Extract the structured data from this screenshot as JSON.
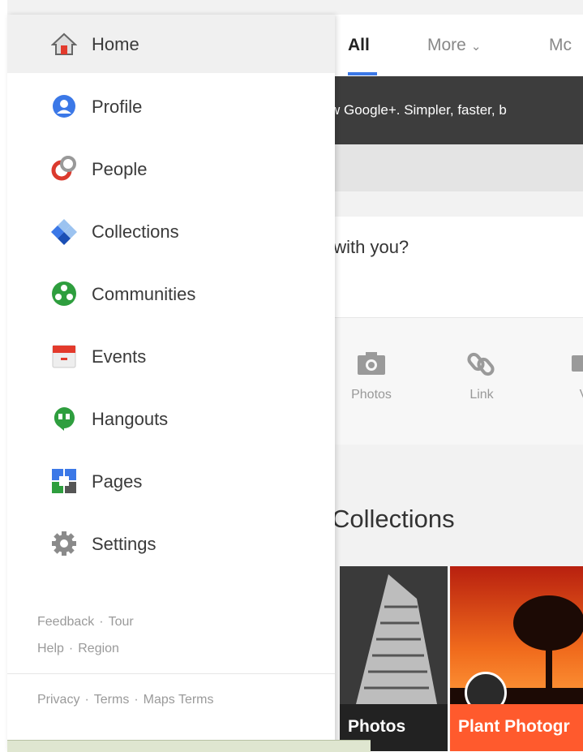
{
  "topbar": {
    "tabs": [
      {
        "label": "All",
        "active": true
      },
      {
        "label": "More"
      },
      {
        "label": "Mc"
      }
    ]
  },
  "banner": {
    "text": "w Google+.  Simpler, faster, b"
  },
  "share": {
    "prompt": "/ with you?",
    "actions": [
      {
        "label": "Photos",
        "icon": "camera-icon"
      },
      {
        "label": "Link",
        "icon": "link-icon"
      },
      {
        "label": "V",
        "icon": "video-icon"
      }
    ]
  },
  "collections": {
    "title": "Collections",
    "tiles": [
      {
        "caption": "Photos"
      },
      {
        "caption": "Plant Photogr"
      }
    ]
  },
  "drawer": {
    "items": [
      {
        "label": "Home",
        "icon": "home-icon",
        "active": true
      },
      {
        "label": "Profile",
        "icon": "profile-icon"
      },
      {
        "label": "People",
        "icon": "people-icon"
      },
      {
        "label": "Collections",
        "icon": "collections-icon"
      },
      {
        "label": "Communities",
        "icon": "communities-icon"
      },
      {
        "label": "Events",
        "icon": "events-icon"
      },
      {
        "label": "Hangouts",
        "icon": "hangouts-icon"
      },
      {
        "label": "Pages",
        "icon": "pages-icon"
      },
      {
        "label": "Settings",
        "icon": "settings-icon"
      }
    ],
    "footer": {
      "row1": [
        "Feedback",
        "Tour"
      ],
      "row2": [
        "Help",
        "Region"
      ],
      "row3": [
        "Privacy",
        "Terms",
        "Maps Terms"
      ]
    }
  },
  "colors": {
    "accent": "#3b78e7",
    "banner": "#3d3d3d",
    "plant_tile": "#ff5a2d"
  }
}
